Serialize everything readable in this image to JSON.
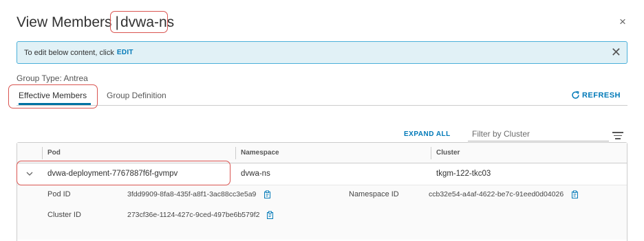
{
  "dialog": {
    "title_prefix": "View Members",
    "title_separator": "|",
    "title_namespace": "dvwa-ns",
    "close_glyph": "×"
  },
  "alert": {
    "text": "To edit below content, click",
    "link": "EDIT",
    "close_glyph": "✕"
  },
  "group_type": "Group Type: Antrea",
  "tabs": [
    {
      "label": "Effective Members",
      "active": true
    },
    {
      "label": "Group Definition",
      "active": false
    }
  ],
  "refresh_label": "REFRESH",
  "toolbar": {
    "expand_all": "EXPAND ALL",
    "filter_placeholder": "Filter by Cluster"
  },
  "table": {
    "columns": [
      "Pod",
      "Namespace",
      "Cluster"
    ],
    "rows": [
      {
        "pod": "dvwa-deployment-7767887f6f-gvmpv",
        "namespace": "dvwa-ns",
        "cluster": "tkgm-122-tkc03",
        "details": {
          "pod_id_label": "Pod ID",
          "pod_id": "3fdd9909-8fa8-435f-a8f1-3ac88cc3e5a9",
          "namespace_id_label": "Namespace ID",
          "namespace_id": "ccb32e54-a4af-4622-be7c-91eed0d04026",
          "cluster_id_label": "Cluster ID",
          "cluster_id": "273cf36e-1124-427c-9ced-497be6b579f2"
        }
      }
    ]
  },
  "icons": {
    "copy": "copy-icon",
    "refresh": "refresh-icon",
    "caret": "chevron-down-icon",
    "columns": "column-toggle-icon"
  },
  "colors": {
    "accent": "#0079b8",
    "alert_bg": "#e1f1f6",
    "alert_border": "#49afd9",
    "highlight": "#d9534f",
    "tab_underline": "#0072a3"
  }
}
